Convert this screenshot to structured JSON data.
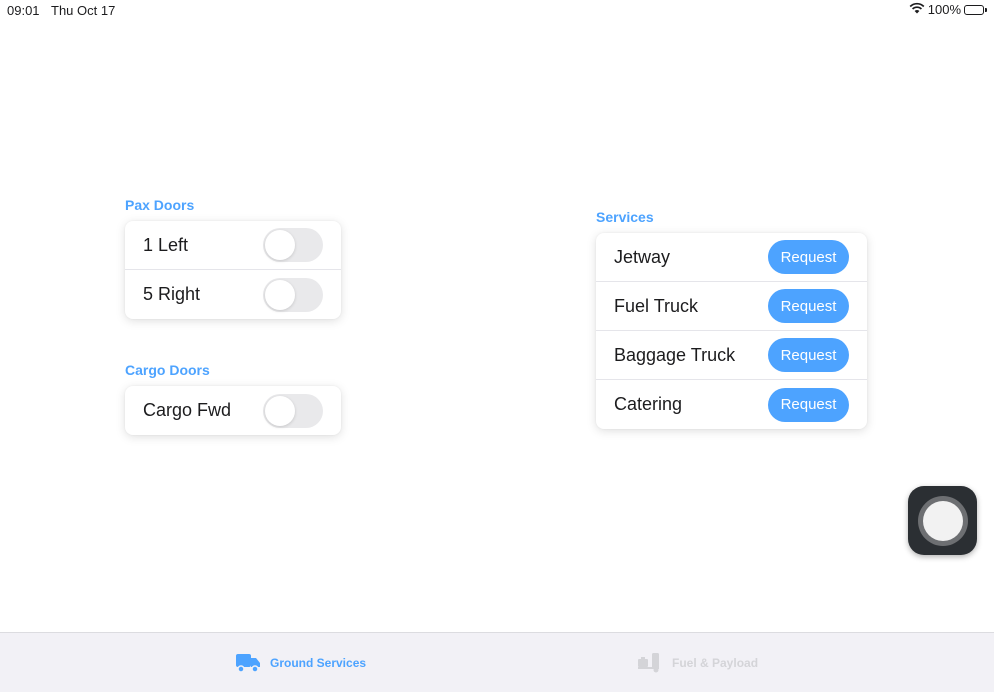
{
  "status_bar": {
    "time": "09:01",
    "date": "Thu Oct 17",
    "battery": "100%",
    "wifi_icon": "wifi-icon",
    "battery_icon": "battery-icon"
  },
  "pax_doors": {
    "title": "Pax Doors",
    "items": [
      {
        "label": "1 Left",
        "on": false
      },
      {
        "label": "5 Right",
        "on": false
      }
    ]
  },
  "cargo_doors": {
    "title": "Cargo Doors",
    "items": [
      {
        "label": "Cargo Fwd",
        "on": false
      }
    ]
  },
  "services": {
    "title": "Services",
    "items": [
      {
        "label": "Jetway",
        "button": "Request"
      },
      {
        "label": "Fuel Truck",
        "button": "Request"
      },
      {
        "label": "Baggage Truck",
        "button": "Request"
      },
      {
        "label": "Catering",
        "button": "Request"
      }
    ]
  },
  "tab_bar": {
    "tabs": [
      {
        "label": "Ground Services",
        "icon": "truck-icon",
        "active": true
      },
      {
        "label": "Fuel & Payload",
        "icon": "hand-truck-icon",
        "active": false
      }
    ]
  },
  "colors": {
    "accent": "#4da3ff",
    "toggle_off": "#e9e9eb",
    "tab_inactive": "#d4d4d8",
    "tab_bar_bg": "#f2f1f6"
  }
}
